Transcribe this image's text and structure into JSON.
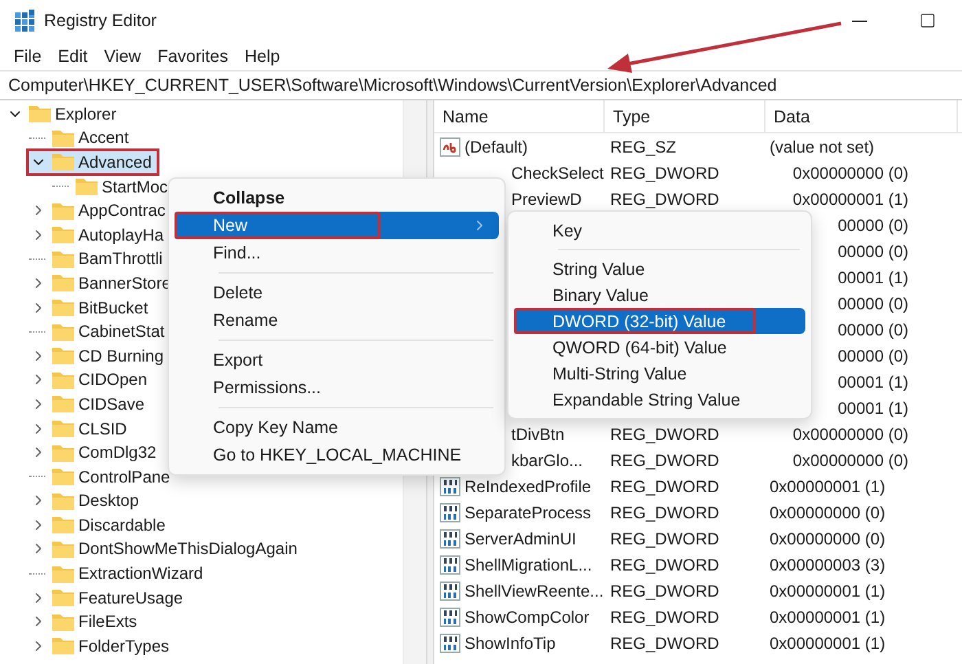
{
  "window": {
    "title": "Registry Editor"
  },
  "menu_bar": [
    "File",
    "Edit",
    "View",
    "Favorites",
    "Help"
  ],
  "address": "Computer\\HKEY_CURRENT_USER\\Software\\Microsoft\\Windows\\CurrentVersion\\Explorer\\Advanced",
  "tree": [
    {
      "label": "Explorer",
      "expanded": true,
      "selected": false,
      "highlighted": false,
      "children": [
        {
          "label": "Accent",
          "selected": false,
          "highlighted": false
        },
        {
          "label": "Advanced",
          "expanded": true,
          "selected": true,
          "highlighted": true,
          "children": [
            {
              "label": "StartMoc",
              "selected": false,
              "highlighted": false
            }
          ]
        },
        {
          "label": "AppContrac",
          "expanded": false,
          "selected": false,
          "highlighted": false
        },
        {
          "label": "AutoplayHa",
          "expanded": false,
          "selected": false,
          "highlighted": false
        },
        {
          "label": "BamThrottli",
          "selected": false,
          "highlighted": false
        },
        {
          "label": "BannerStore",
          "expanded": false,
          "selected": false,
          "highlighted": false
        },
        {
          "label": "BitBucket",
          "expanded": false,
          "selected": false,
          "highlighted": false
        },
        {
          "label": "CabinetStat",
          "selected": false,
          "highlighted": false
        },
        {
          "label": "CD Burning",
          "expanded": false,
          "selected": false,
          "highlighted": false
        },
        {
          "label": "CIDOpen",
          "expanded": false,
          "selected": false,
          "highlighted": false
        },
        {
          "label": "CIDSave",
          "expanded": false,
          "selected": false,
          "highlighted": false
        },
        {
          "label": "CLSID",
          "expanded": false,
          "selected": false,
          "highlighted": false
        },
        {
          "label": "ComDlg32",
          "expanded": false,
          "selected": false,
          "highlighted": false
        },
        {
          "label": "ControlPane",
          "selected": false,
          "highlighted": false
        },
        {
          "label": "Desktop",
          "expanded": false,
          "selected": false,
          "highlighted": false
        },
        {
          "label": "Discardable",
          "expanded": false,
          "selected": false,
          "highlighted": false
        },
        {
          "label": "DontShowMeThisDialogAgain",
          "expanded": false,
          "selected": false,
          "highlighted": false
        },
        {
          "label": "ExtractionWizard",
          "selected": false,
          "highlighted": false
        },
        {
          "label": "FeatureUsage",
          "expanded": false,
          "selected": false,
          "highlighted": false
        },
        {
          "label": "FileExts",
          "expanded": false,
          "selected": false,
          "highlighted": false
        },
        {
          "label": "FolderTypes",
          "expanded": false,
          "selected": false,
          "highlighted": false
        }
      ]
    }
  ],
  "table": {
    "columns": [
      "Name",
      "Type",
      "Data"
    ],
    "rows": [
      {
        "kind": "string",
        "name": "(Default)",
        "type": "REG_SZ",
        "data": "(value not set)"
      },
      {
        "kind": "clipped",
        "name": "CheckSelect",
        "type": "REG_DWORD",
        "data": "0x00000000 (0)"
      },
      {
        "kind": "clipped",
        "name": "PreviewD",
        "type": "REG_DWORD",
        "data": "0x00000001 (1)"
      },
      {
        "kind": "clipped",
        "data": "00000 (0)"
      },
      {
        "kind": "clipped",
        "data": "00000 (0)"
      },
      {
        "kind": "clipped",
        "data": "00001 (1)"
      },
      {
        "kind": "clipped",
        "data": "00000 (0)"
      },
      {
        "kind": "clipped",
        "data": "00000 (0)"
      },
      {
        "kind": "clipped",
        "data": "00000 (0)"
      },
      {
        "kind": "clipped",
        "data": "00001 (1)"
      },
      {
        "kind": "clipped",
        "data": "00001 (1)"
      },
      {
        "kind": "clipped",
        "name": "tDivBtn",
        "type": "REG_DWORD",
        "data": "0x00000000 (0)"
      },
      {
        "kind": "clipped",
        "name": "kbarGlo...",
        "type": "REG_DWORD",
        "data": "0x00000000 (0)"
      },
      {
        "kind": "dword",
        "name": "ReIndexedProfile",
        "type": "REG_DWORD",
        "data": "0x00000001 (1)"
      },
      {
        "kind": "dword",
        "name": "SeparateProcess",
        "type": "REG_DWORD",
        "data": "0x00000000 (0)"
      },
      {
        "kind": "dword",
        "name": "ServerAdminUI",
        "type": "REG_DWORD",
        "data": "0x00000000 (0)"
      },
      {
        "kind": "dword",
        "name": "ShellMigrationL...",
        "type": "REG_DWORD",
        "data": "0x00000003 (3)"
      },
      {
        "kind": "dword",
        "name": "ShellViewReente...",
        "type": "REG_DWORD",
        "data": "0x00000001 (1)"
      },
      {
        "kind": "dword",
        "name": "ShowCompColor",
        "type": "REG_DWORD",
        "data": "0x00000001 (1)"
      },
      {
        "kind": "dword",
        "name": "ShowInfoTip",
        "type": "REG_DWORD",
        "data": "0x00000001 (1)"
      }
    ]
  },
  "context_menu": {
    "items": [
      {
        "kind": "item",
        "label": "Collapse",
        "bold": true,
        "selected": false,
        "highlighted": false
      },
      {
        "kind": "submenu",
        "label": "New",
        "bold": false,
        "selected": true,
        "highlighted": true
      },
      {
        "kind": "item",
        "label": "Find...",
        "bold": false,
        "selected": false,
        "highlighted": false
      },
      {
        "kind": "separator"
      },
      {
        "kind": "item",
        "label": "Delete",
        "bold": false,
        "selected": false,
        "highlighted": false
      },
      {
        "kind": "item",
        "label": "Rename",
        "bold": false,
        "selected": false,
        "highlighted": false
      },
      {
        "kind": "separator"
      },
      {
        "kind": "item",
        "label": "Export",
        "bold": false,
        "selected": false,
        "highlighted": false
      },
      {
        "kind": "item",
        "label": "Permissions...",
        "bold": false,
        "selected": false,
        "highlighted": false
      },
      {
        "kind": "separator"
      },
      {
        "kind": "item",
        "label": "Copy Key Name",
        "bold": false,
        "selected": false,
        "highlighted": false
      },
      {
        "kind": "item",
        "label": "Go to HKEY_LOCAL_MACHINE",
        "bold": false,
        "selected": false,
        "highlighted": false
      }
    ]
  },
  "submenu": {
    "items": [
      {
        "kind": "item",
        "label": "Key",
        "selected": false,
        "highlighted": false
      },
      {
        "kind": "separator"
      },
      {
        "kind": "item",
        "label": "String Value",
        "selected": false,
        "highlighted": false
      },
      {
        "kind": "item",
        "label": "Binary Value",
        "selected": false,
        "highlighted": false
      },
      {
        "kind": "item",
        "label": "DWORD (32-bit) Value",
        "selected": true,
        "highlighted": true
      },
      {
        "kind": "item",
        "label": "QWORD (64-bit) Value",
        "selected": false,
        "highlighted": false
      },
      {
        "kind": "item",
        "label": "Multi-String Value",
        "selected": false,
        "highlighted": false
      },
      {
        "kind": "item",
        "label": "Expandable String Value",
        "selected": false,
        "highlighted": false
      }
    ]
  }
}
